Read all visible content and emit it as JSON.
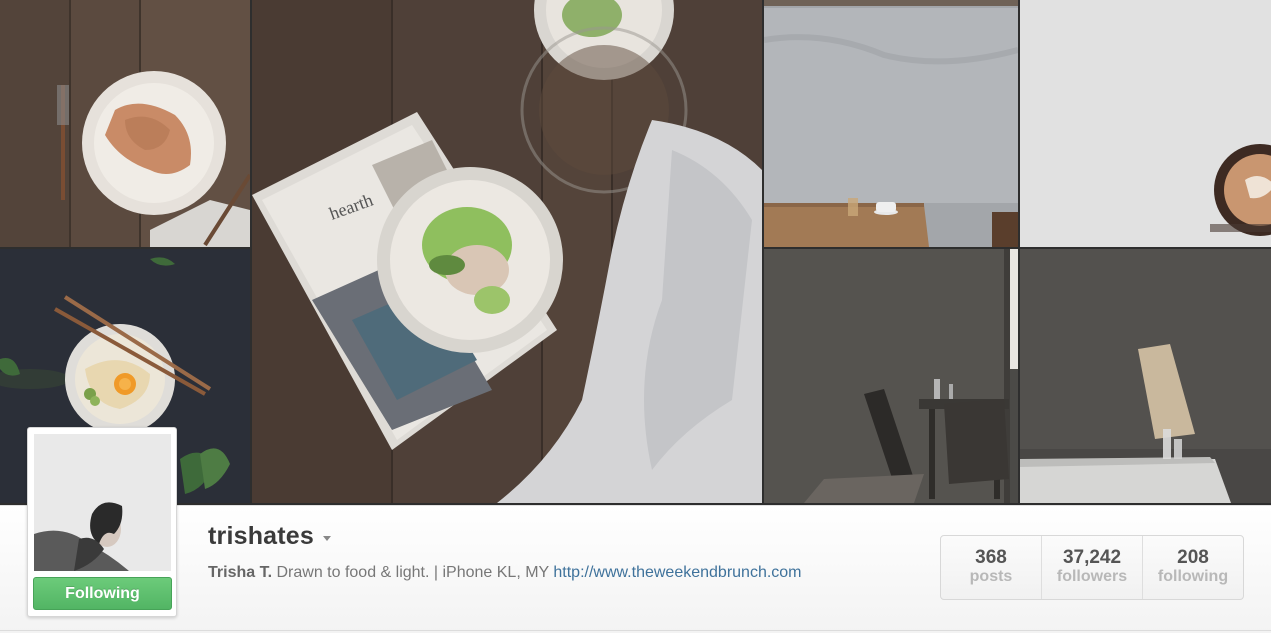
{
  "profile": {
    "username": "trishates",
    "full_name": "Trisha T.",
    "bio": " Drawn to food & light. | iPhone KL, MY ",
    "website": "http://www.theweekendbrunch.com",
    "follow_button_label": "Following"
  },
  "stats": [
    {
      "value": "368",
      "label": "posts"
    },
    {
      "value": "37,242",
      "label": "followers"
    },
    {
      "value": "208",
      "label": "following"
    }
  ],
  "colors": {
    "follow_green": "#5cbd6d",
    "link_blue": "#3f729b"
  },
  "icons": {
    "dropdown": "caret-down-icon"
  }
}
